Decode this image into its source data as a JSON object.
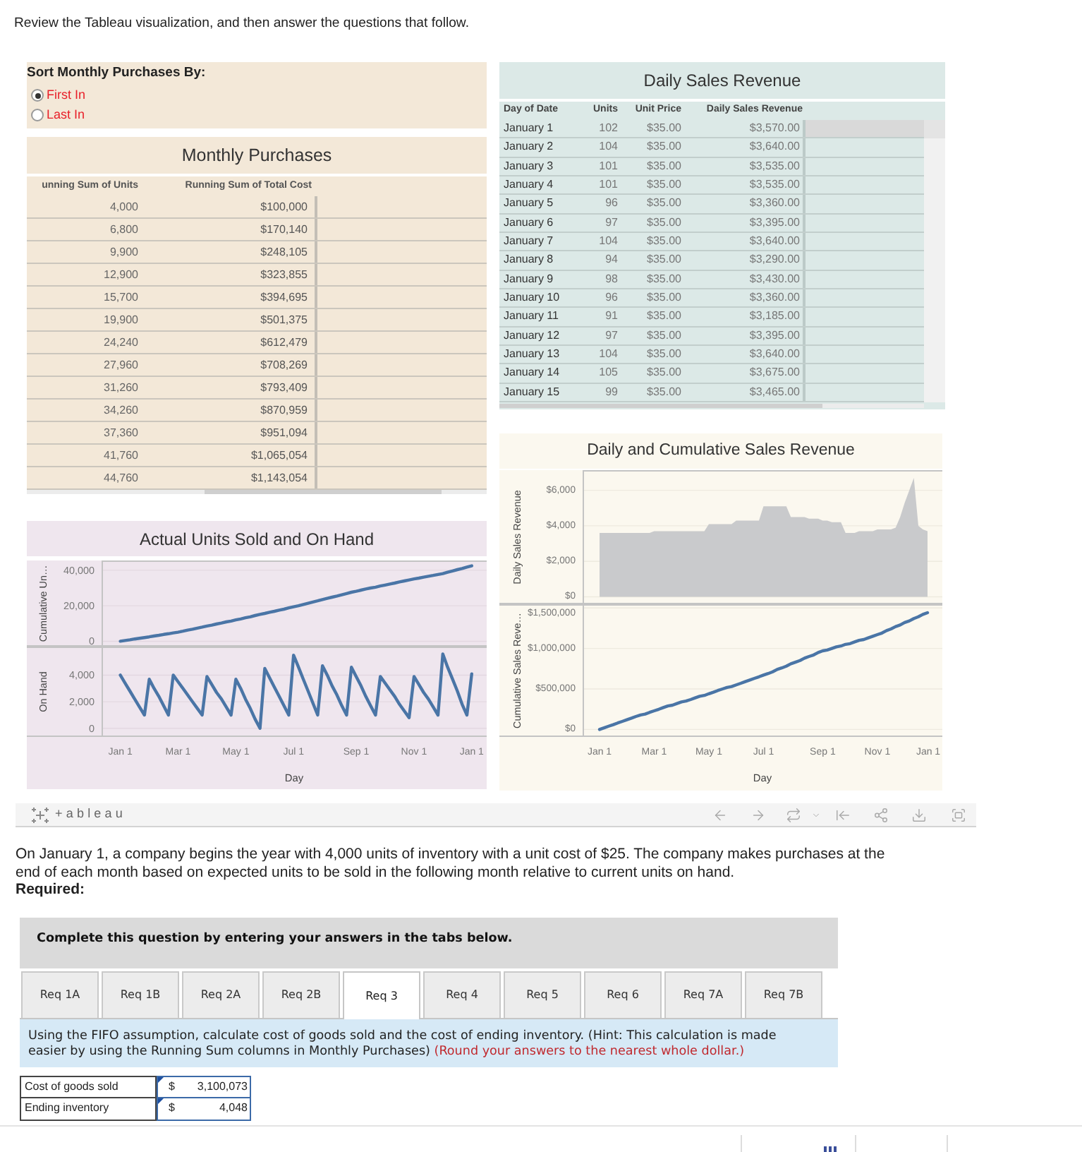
{
  "instructions": "Review the Tableau visualization, and then answer the questions that follow.",
  "dashboard": {
    "sort_control": {
      "title": "Sort Monthly Purchases By:",
      "options": [
        {
          "label": "First In",
          "selected": true
        },
        {
          "label": "Last In",
          "selected": false
        }
      ]
    },
    "monthly_purchases": {
      "title": "Monthly Purchases",
      "columns": [
        "unning Sum of Units",
        "Running Sum of Total Cost"
      ],
      "rows": [
        [
          "4,000",
          "$100,000"
        ],
        [
          "6,800",
          "$170,140"
        ],
        [
          "9,900",
          "$248,105"
        ],
        [
          "12,900",
          "$323,855"
        ],
        [
          "15,700",
          "$394,695"
        ],
        [
          "19,900",
          "$501,375"
        ],
        [
          "24,240",
          "$612,479"
        ],
        [
          "27,960",
          "$708,269"
        ],
        [
          "31,260",
          "$793,409"
        ],
        [
          "34,260",
          "$870,959"
        ],
        [
          "37,360",
          "$951,094"
        ],
        [
          "41,760",
          "$1,065,054"
        ],
        [
          "44,760",
          "$1,143,054"
        ]
      ]
    },
    "daily_sales_revenue": {
      "title": "Daily Sales Revenue",
      "columns": [
        "Day of Date",
        "Units",
        "Unit Price",
        "Daily Sales Revenue"
      ],
      "rows": [
        {
          "cells": [
            "January 1",
            "102",
            "$35.00",
            "$3,570.00"
          ],
          "highlighted": true
        },
        {
          "cells": [
            "January 2",
            "104",
            "$35.00",
            "$3,640.00"
          ],
          "highlighted": false
        },
        {
          "cells": [
            "January 3",
            "101",
            "$35.00",
            "$3,535.00"
          ],
          "highlighted": false
        },
        {
          "cells": [
            "January 4",
            "101",
            "$35.00",
            "$3,535.00"
          ],
          "highlighted": false
        },
        {
          "cells": [
            "January 5",
            "96",
            "$35.00",
            "$3,360.00"
          ],
          "highlighted": false
        },
        {
          "cells": [
            "January 6",
            "97",
            "$35.00",
            "$3,395.00"
          ],
          "highlighted": false
        },
        {
          "cells": [
            "January 7",
            "104",
            "$35.00",
            "$3,640.00"
          ],
          "highlighted": false
        },
        {
          "cells": [
            "January 8",
            "94",
            "$35.00",
            "$3,290.00"
          ],
          "highlighted": false
        },
        {
          "cells": [
            "January 9",
            "98",
            "$35.00",
            "$3,430.00"
          ],
          "highlighted": false
        },
        {
          "cells": [
            "January 10",
            "96",
            "$35.00",
            "$3,360.00"
          ],
          "highlighted": false
        },
        {
          "cells": [
            "January 11",
            "91",
            "$35.00",
            "$3,185.00"
          ],
          "highlighted": false
        },
        {
          "cells": [
            "January 12",
            "97",
            "$35.00",
            "$3,395.00"
          ],
          "highlighted": false
        },
        {
          "cells": [
            "January 13",
            "104",
            "$35.00",
            "$3,640.00"
          ],
          "highlighted": false
        },
        {
          "cells": [
            "January 14",
            "105",
            "$35.00",
            "$3,675.00"
          ],
          "highlighted": false
        },
        {
          "cells": [
            "January 15",
            "99",
            "$35.00",
            "$3,465.00"
          ],
          "highlighted": false
        }
      ]
    },
    "units_chart": {
      "title": "Actual Units Sold and On Hand",
      "panes": [
        {
          "chart_data": {
            "type": "line",
            "ylabel": "Cumulative Un…",
            "grid": true,
            "categories": [
              null,
              null,
              null,
              null,
              null,
              null,
              null,
              null,
              null,
              null,
              null,
              null,
              null,
              null,
              null,
              null,
              null,
              null,
              null,
              null,
              null,
              null,
              null,
              null,
              null,
              null,
              null,
              null,
              null,
              null,
              null,
              null,
              null,
              null,
              null,
              null,
              null,
              null,
              null,
              null,
              null,
              null,
              null,
              null,
              null,
              null,
              null,
              null,
              null,
              null,
              null,
              null,
              null,
              null,
              null,
              null,
              null,
              null,
              null,
              null,
              null,
              null,
              null,
              null,
              null,
              null,
              null,
              null,
              null,
              null,
              null,
              null,
              null,
              null
            ],
            "values": [
              0,
              400,
              800,
              1300,
              1700,
              2100,
              2500,
              3000,
              3400,
              3800,
              4200,
              4700,
              5100,
              5700,
              6300,
              6800,
              7400,
              8000,
              8600,
              9100,
              9700,
              10300,
              10900,
              11400,
              12000,
              12600,
              13200,
              13800,
              14500,
              15100,
              15700,
              16300,
              16900,
              17500,
              18100,
              18800,
              19400,
              20000,
              20700,
              21400,
              22100,
              22800,
              23500,
              24200,
              24800,
              25500,
              26200,
              26900,
              27600,
              28200,
              28800,
              29400,
              30000,
              30500,
              31100,
              31700,
              32200,
              32800,
              33400,
              34000,
              34500,
              35100,
              35600,
              36100,
              36600,
              37100,
              37600,
              38100,
              38900,
              39600,
              40300,
              41000,
              41800,
              42500
            ],
            "ylim": [
              -3000,
              45500
            ],
            "yticks": [
              {
                "value": 0,
                "label": "0"
              },
              {
                "value": 20000,
                "label": "20,000"
              },
              {
                "value": 40000,
                "label": "40,000"
              }
            ]
          }
        },
        {
          "chart_data": {
            "type": "line",
            "ylabel": "On Hand",
            "xlabel": "Day",
            "grid": true,
            "categories": [
              "Jan 1",
              null,
              null,
              null,
              null,
              null,
              null,
              null,
              null,
              null,
              null,
              null,
              "Mar 1",
              null,
              null,
              null,
              null,
              null,
              null,
              null,
              null,
              null,
              null,
              null,
              "May 1",
              null,
              null,
              null,
              null,
              null,
              null,
              null,
              null,
              null,
              null,
              null,
              "Jul 1",
              null,
              null,
              null,
              null,
              null,
              null,
              null,
              null,
              null,
              null,
              null,
              null,
              "Sep 1",
              null,
              null,
              null,
              null,
              null,
              null,
              null,
              null,
              null,
              null,
              null,
              "Nov 1",
              null,
              null,
              null,
              null,
              null,
              null,
              null,
              null,
              null,
              null,
              null,
              "Jan 1"
            ],
            "values": [
              4000,
              3400,
              2800,
              2200,
              1600,
              1000,
              3700,
              3000,
              2400,
              1700,
              1000,
              4000,
              3500,
              3000,
              2500,
              2000,
              1500,
              1000,
              3900,
              3300,
              2700,
              2200,
              1600,
              1000,
              3700,
              3000,
              2200,
              1500,
              700,
              0,
              4500,
              3800,
              3100,
              2400,
              1700,
              1000,
              5500,
              4600,
              3700,
              2800,
              1900,
              1000,
              4700,
              4000,
              3200,
              2500,
              1700,
              1000,
              4600,
              3900,
              3200,
              2400,
              1700,
              1000,
              3900,
              3400,
              2900,
              2400,
              1800,
              1300,
              800,
              3900,
              3300,
              2700,
              2200,
              1600,
              1000,
              5600,
              4600,
              3700,
              2800,
              1800,
              1000,
              4100
            ],
            "ylim": [
              -650,
              6150
            ],
            "yticks": [
              {
                "value": 0,
                "label": "0"
              },
              {
                "value": 2000,
                "label": "2,000"
              },
              {
                "value": 4000,
                "label": "4,000"
              }
            ]
          }
        }
      ]
    },
    "revenue_chart": {
      "title": "Daily and Cumulative Sales Revenue",
      "panes": [
        {
          "chart_data": {
            "type": "area",
            "ylabel": "Daily Sales Revenue",
            "grid": true,
            "categories": [
              null,
              null,
              null,
              null,
              null,
              null,
              null,
              null,
              null,
              null,
              null,
              null,
              null,
              null,
              null,
              null,
              null,
              null,
              null,
              null,
              null,
              null,
              null,
              null,
              null,
              null,
              null,
              null,
              null,
              null,
              null,
              null,
              null,
              null,
              null,
              null,
              null,
              null,
              null,
              null,
              null,
              null,
              null,
              null,
              null,
              null,
              null,
              null,
              null,
              null,
              null,
              null,
              null,
              null,
              null,
              null,
              null,
              null,
              null,
              null,
              null,
              null,
              null,
              null,
              null,
              null,
              null,
              null,
              null,
              null,
              null,
              null,
              null,
              null
            ],
            "values": [
              3600,
              3600,
              3600,
              3600,
              3600,
              3600,
              3600,
              3600,
              3600,
              3600,
              3600,
              3600,
              3700,
              3700,
              3700,
              3700,
              3700,
              3700,
              3700,
              3700,
              3700,
              3700,
              3700,
              3700,
              4100,
              4100,
              4100,
              4100,
              4100,
              4100,
              4300,
              4300,
              4300,
              4300,
              4300,
              4300,
              5100,
              5100,
              5100,
              5100,
              5100,
              5100,
              4500,
              4500,
              4500,
              4500,
              4400,
              4400,
              4400,
              4300,
              4300,
              4200,
              4200,
              4200,
              3600,
              3600,
              3600,
              3700,
              3700,
              3700,
              3700,
              3800,
              3800,
              3800,
              3800,
              3900,
              4500,
              5300,
              6000,
              6700,
              4000,
              3800,
              3700,
              null
            ],
            "ylim": [
              -420,
              7140
            ],
            "yticks": [
              {
                "value": 0,
                "label": "$0"
              },
              {
                "value": 2000,
                "label": "$2,000"
              },
              {
                "value": 4000,
                "label": "$4,000"
              },
              {
                "value": 6000,
                "label": "$6,000"
              }
            ]
          }
        },
        {
          "chart_data": {
            "type": "line",
            "ylabel": "Cumulative Sales Reve…",
            "xlabel": "Day",
            "grid": true,
            "categories": [
              "Jan 1",
              null,
              null,
              null,
              null,
              null,
              null,
              null,
              null,
              null,
              null,
              null,
              "Mar 1",
              null,
              null,
              null,
              null,
              null,
              null,
              null,
              null,
              null,
              null,
              null,
              "May 1",
              null,
              null,
              null,
              null,
              null,
              null,
              null,
              null,
              null,
              null,
              null,
              "Jul 1",
              null,
              null,
              null,
              null,
              null,
              null,
              null,
              null,
              null,
              null,
              null,
              null,
              "Sep 1",
              null,
              null,
              null,
              null,
              null,
              null,
              null,
              null,
              null,
              null,
              null,
              "Nov 1",
              null,
              null,
              null,
              null,
              null,
              null,
              null,
              null,
              null,
              null,
              null,
              "Jan 1"
            ],
            "values": [
              0,
              20000,
              40000,
              60000,
              80000,
              100000,
              120000,
              140000,
              160000,
              180000,
              190000,
              210000,
              230000,
              250000,
              270000,
              290000,
              300000,
              320000,
              340000,
              350000,
              370000,
              390000,
              410000,
              420000,
              440000,
              460000,
              480000,
              500000,
              520000,
              530000,
              550000,
              570000,
              590000,
              610000,
              630000,
              650000,
              670000,
              690000,
              710000,
              740000,
              760000,
              780000,
              810000,
              830000,
              850000,
              880000,
              900000,
              920000,
              950000,
              970000,
              980000,
              1000000,
              1020000,
              1030000,
              1050000,
              1060000,
              1080000,
              1100000,
              1110000,
              1130000,
              1150000,
              1170000,
              1190000,
              1220000,
              1240000,
              1270000,
              1290000,
              1320000,
              1340000,
              1370000,
              1390000,
              1420000,
              1440000,
              null
            ],
            "ylim": [
              -92300,
              1545300
            ],
            "yticks": [
              {
                "value": 0,
                "label": "$0"
              },
              {
                "value": 500000,
                "label": "$500,000"
              },
              {
                "value": 1000000,
                "label": "$1,000,000"
              },
              {
                "value": 1500000,
                "label": "$1,500,000"
              }
            ]
          }
        }
      ]
    }
  },
  "toolbar": {
    "logo_text": "+ableau"
  },
  "problem_text": "On January 1, a company begins the year with 4,000 units of inventory with a unit cost of $25. The company makes purchases at the end of each month based on expected units to be sold in the following month relative to current units on hand.",
  "required_label": "Required:",
  "banner": "Complete this question by entering your answers in the tabs below.",
  "tabs": [
    {
      "label": "Req 1A",
      "selected": false
    },
    {
      "label": "Req 1B",
      "selected": false
    },
    {
      "label": "Req 2A",
      "selected": false
    },
    {
      "label": "Req 2B",
      "selected": false
    },
    {
      "label": "Req 3",
      "selected": true
    },
    {
      "label": "Req 4",
      "selected": false
    },
    {
      "label": "Req 5",
      "selected": false
    },
    {
      "label": "Req 6",
      "selected": false
    },
    {
      "label": "Req 7A",
      "selected": false
    },
    {
      "label": "Req 7B",
      "selected": false
    }
  ],
  "hint": {
    "text": "Using the FIFO assumption, calculate cost of goods sold and the cost of ending inventory. (Hint: This calculation is made easier by using the Running Sum columns in Monthly Purchases)",
    "note": "(Round your answers to the nearest whole dollar.)"
  },
  "answers": [
    {
      "label": "Cost of goods sold",
      "currency": "$",
      "value": "3,100,073"
    },
    {
      "label": "Ending inventory",
      "currency": "$",
      "value": "4,048"
    }
  ]
}
